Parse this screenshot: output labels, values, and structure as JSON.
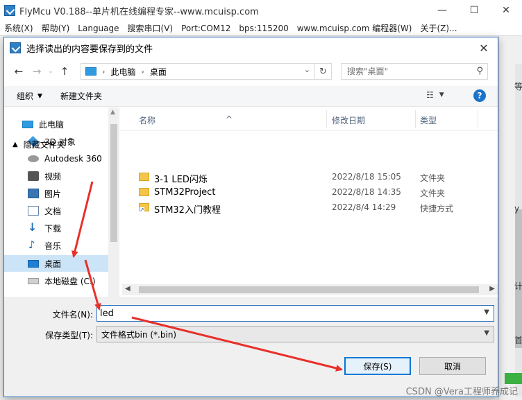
{
  "app": {
    "title": "FlyMcu V0.188--单片机在线编程专家--www.mcuisp.com",
    "window_controls": [
      "—",
      "☐",
      "✕"
    ],
    "menu": [
      "系统(X)",
      "帮助(Y)",
      "Language",
      "搜索串口(V)",
      "Port:COM12",
      "bps:115200",
      "www.mcuisp.com 编程器(W)",
      "关于(Z)..."
    ],
    "bg_fragments": [
      "等",
      "y",
      "计",
      "首"
    ]
  },
  "dialog": {
    "title": "选择读出的内容要保存到的文件",
    "close": "✕",
    "address": {
      "crumbs": [
        "此电脑",
        "桌面"
      ],
      "search_placeholder": "搜索\"桌面\""
    },
    "toolbar": {
      "organize": "组织",
      "new_folder": "新建文件夹",
      "help": "?"
    },
    "nav": [
      {
        "label": "此电脑",
        "icon": "pc-icon"
      },
      {
        "label": "3D 对象",
        "icon": "3d-objects-icon"
      },
      {
        "label": "Autodesk 360",
        "icon": "autodesk-icon"
      },
      {
        "label": "视频",
        "icon": "video-icon"
      },
      {
        "label": "图片",
        "icon": "picture-icon"
      },
      {
        "label": "文档",
        "icon": "document-icon"
      },
      {
        "label": "下载",
        "icon": "download-icon"
      },
      {
        "label": "音乐",
        "icon": "music-icon"
      },
      {
        "label": "桌面",
        "icon": "desktop-icon",
        "selected": true
      },
      {
        "label": "本地磁盘 (C:)",
        "icon": "disk-icon"
      }
    ],
    "columns": {
      "name": "名称",
      "date": "修改日期",
      "type": "类型"
    },
    "files": [
      {
        "name": "3-1 LED闪烁",
        "date": "2022/8/18 15:05",
        "type": "文件夹"
      },
      {
        "name": "STM32Project",
        "date": "2022/8/18 14:35",
        "type": "文件夹"
      },
      {
        "name": "STM32入门教程",
        "date": "2022/8/4 14:29",
        "type": "快捷方式"
      }
    ],
    "form": {
      "filename_label": "文件名(N):",
      "filename_value": "led",
      "filetype_label": "保存类型(T):",
      "filetype_value": "文件格式bin (*.bin)"
    },
    "hide_folders": "隐藏文件夹",
    "save_button": "保存(S)",
    "cancel_button": "取消"
  },
  "watermark": "CSDN @Vera工程师养成记"
}
